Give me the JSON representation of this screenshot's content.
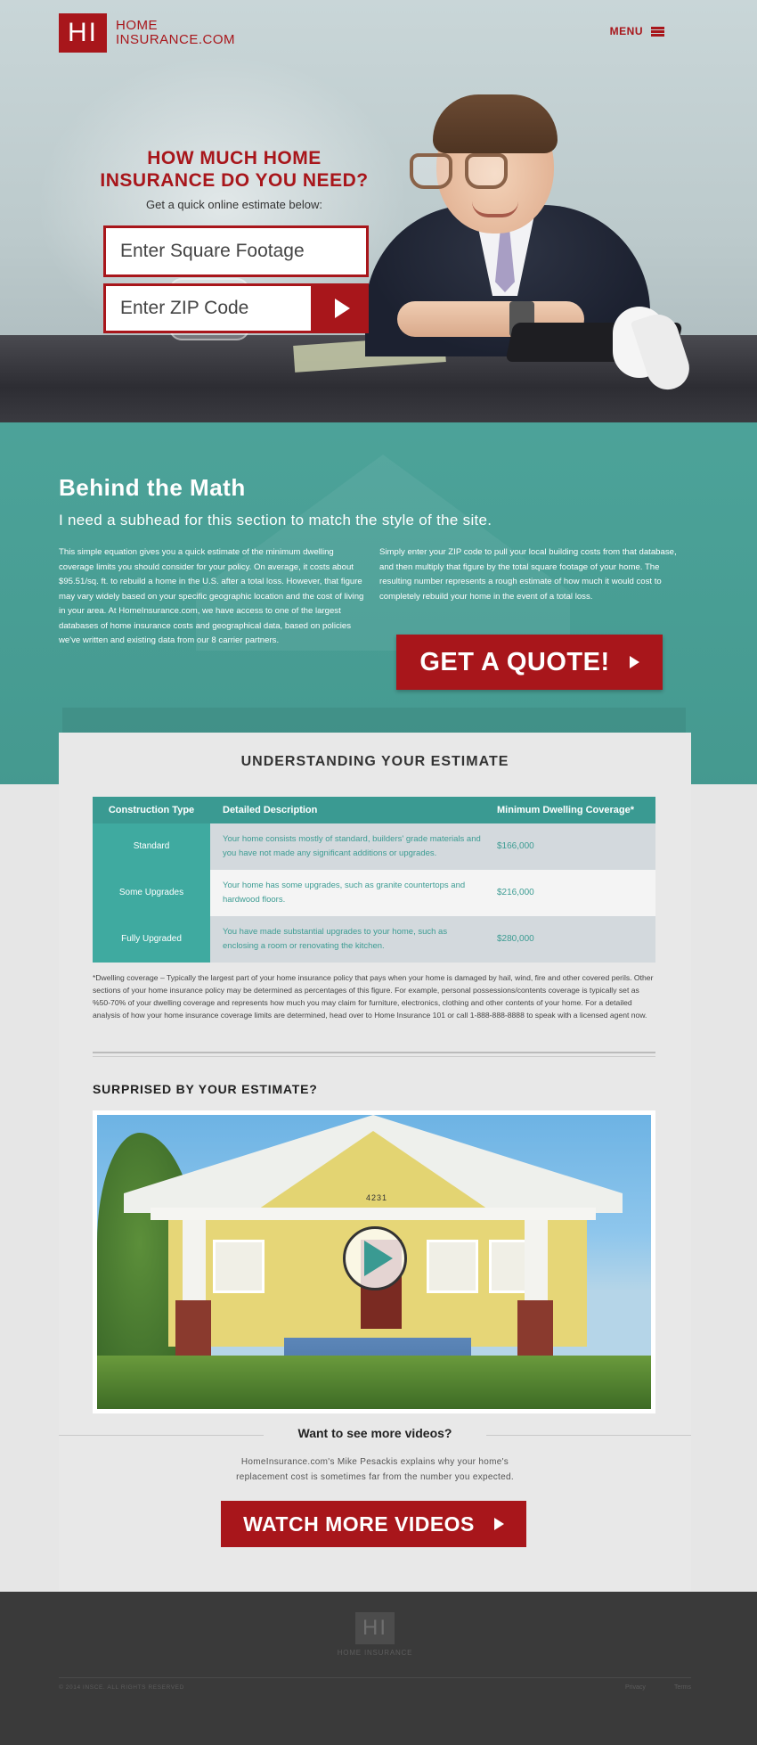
{
  "header": {
    "logo_mark": "HI",
    "logo_line1": "HOME",
    "logo_line2": "INSURANCE.COM",
    "menu_label": "MENU"
  },
  "hero": {
    "title_line1": "HOW MUCH HOME",
    "title_line2": "INSURANCE DO YOU NEED?",
    "subtitle": "Get a quick online estimate below:",
    "sqft_placeholder": "Enter Square Footage",
    "zip_placeholder": "Enter ZIP Code"
  },
  "math": {
    "title": "Behind the Math",
    "subhead": "I need a subhead for this section to match the style of the site.",
    "left_text": "This simple equation gives you a quick estimate of the minimum dwelling coverage limits you should consider for your policy. On average, it costs about $95.51/sq. ft. to rebuild a home in the U.S. after a total loss. However, that figure may vary widely based on your specific geographic location and the cost of living in your area. At HomeInsurance.com, we have access to one of the largest databases of home insurance costs and geographical data, based on policies we've written and existing data from our 8 carrier partners.",
    "right_text": "Simply enter your ZIP code to pull your local building costs from that database, and then multiply that figure by the total square footage of your home. The resulting number represents a rough estimate of how much it would cost to completely rebuild your home in the event of a total loss.",
    "quote_button": "GET A QUOTE!"
  },
  "estimate": {
    "title": "UNDERSTANDING YOUR ESTIMATE",
    "columns": [
      "Construction Type",
      "Detailed Description",
      "Minimum Dwelling Coverage*"
    ],
    "rows": [
      {
        "type": "Standard",
        "description": "Your home consists mostly of standard, builders' grade materials and you have not made any significant additions or upgrades.",
        "coverage": "$166,000"
      },
      {
        "type": "Some Upgrades",
        "description": "Your home has some upgrades, such as granite countertops and hardwood floors.",
        "coverage": "$216,000"
      },
      {
        "type": "Fully Upgraded",
        "description": "You have made substantial upgrades to your home, such as enclosing a room or renovating the kitchen.",
        "coverage": "$280,000"
      }
    ],
    "footnote": "*Dwelling coverage – Typically the largest part of your home insurance policy that pays when your home is damaged by hail, wind, fire and other covered perils. Other sections of your home insurance policy may be determined as percentages of this figure. For example, personal possessions/contents coverage is typically set as %50-70% of your dwelling coverage and represents how much you may claim for furniture, electronics, clothing and other contents of your home. For a detailed analysis of how your home insurance coverage limits are determined, head over to Home Insurance 101 or call 1-888-888-8888 to speak with a licensed agent now."
  },
  "video_section": {
    "heading": "SURPRISED BY YOUR ESTIMATE?",
    "house_number": "4231",
    "more_title": "Want to see more videos?",
    "more_desc_line1": "HomeInsurance.com's Mike Pesackis explains why your home's",
    "more_desc_line2": "replacement cost is sometimes far from the number you expected.",
    "button": "WATCH MORE VIDEOS"
  },
  "footer": {
    "logo_mark": "HI",
    "logo_text": "HOME INSURANCE",
    "copyright": "© 2014 INSCE. ALL RIGHTS RESERVED",
    "links": [
      "Privacy",
      "Terms"
    ]
  },
  "colors": {
    "brand_red": "#a8161b",
    "teal": "#3a9a92"
  }
}
